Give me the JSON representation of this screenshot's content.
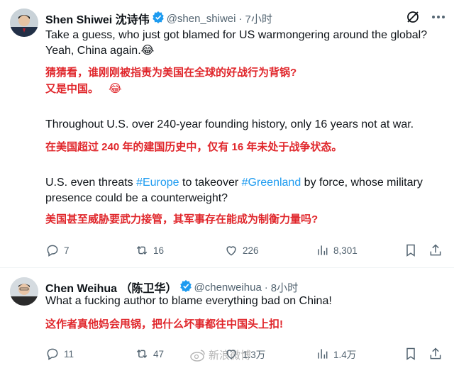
{
  "tweets": [
    {
      "author_name": "Shen Shiwei 沈诗伟",
      "handle": "@shen_shiwei",
      "time": "7小时",
      "text_en_1": "Take a guess, who just got blamed for US warmongering around the global?",
      "text_en_2": "Yeah, China again.",
      "emoji": "😂",
      "text_zh_1": "猜猜看，谁刚刚被指责为美国在全球的好战行为背锅?",
      "text_zh_2": "又是中国。",
      "para2_en": "Throughout U.S. over 240-year founding history, only 16 years not at war.",
      "para2_zh": "在美国超过 240 年的建国历史中，仅有 16 年未处于战争状态。",
      "para3_en_a": "U.S. even threats ",
      "para3_link_1": "#Europe",
      "para3_en_b": " to takeover ",
      "para3_link_2": "#Greenland",
      "para3_en_c": " by force, whose military",
      "para3_en_line2": "presence could be a counterweight?",
      "para3_zh": "美国甚至威胁要武力接管，其军事存在能成为制衡力量吗?",
      "replies": "7",
      "retweets": "16",
      "likes": "226",
      "views": "8,301"
    },
    {
      "author_name": "Chen Weihua （陈卫华）",
      "handle": "@chenweihua",
      "time": "8小时",
      "text_en": "What a fucking author to blame everything bad on China!",
      "text_zh": "这作者真他妈会甩锅，把什么坏事都往中国头上扣!",
      "replies": "11",
      "retweets": "47",
      "likes": "1.3万",
      "views": "1.4万"
    }
  ],
  "watermark": "新浪微博",
  "colors": {
    "accent": "#1d9bf0",
    "zh_text": "#e0262b",
    "muted": "#536471"
  }
}
